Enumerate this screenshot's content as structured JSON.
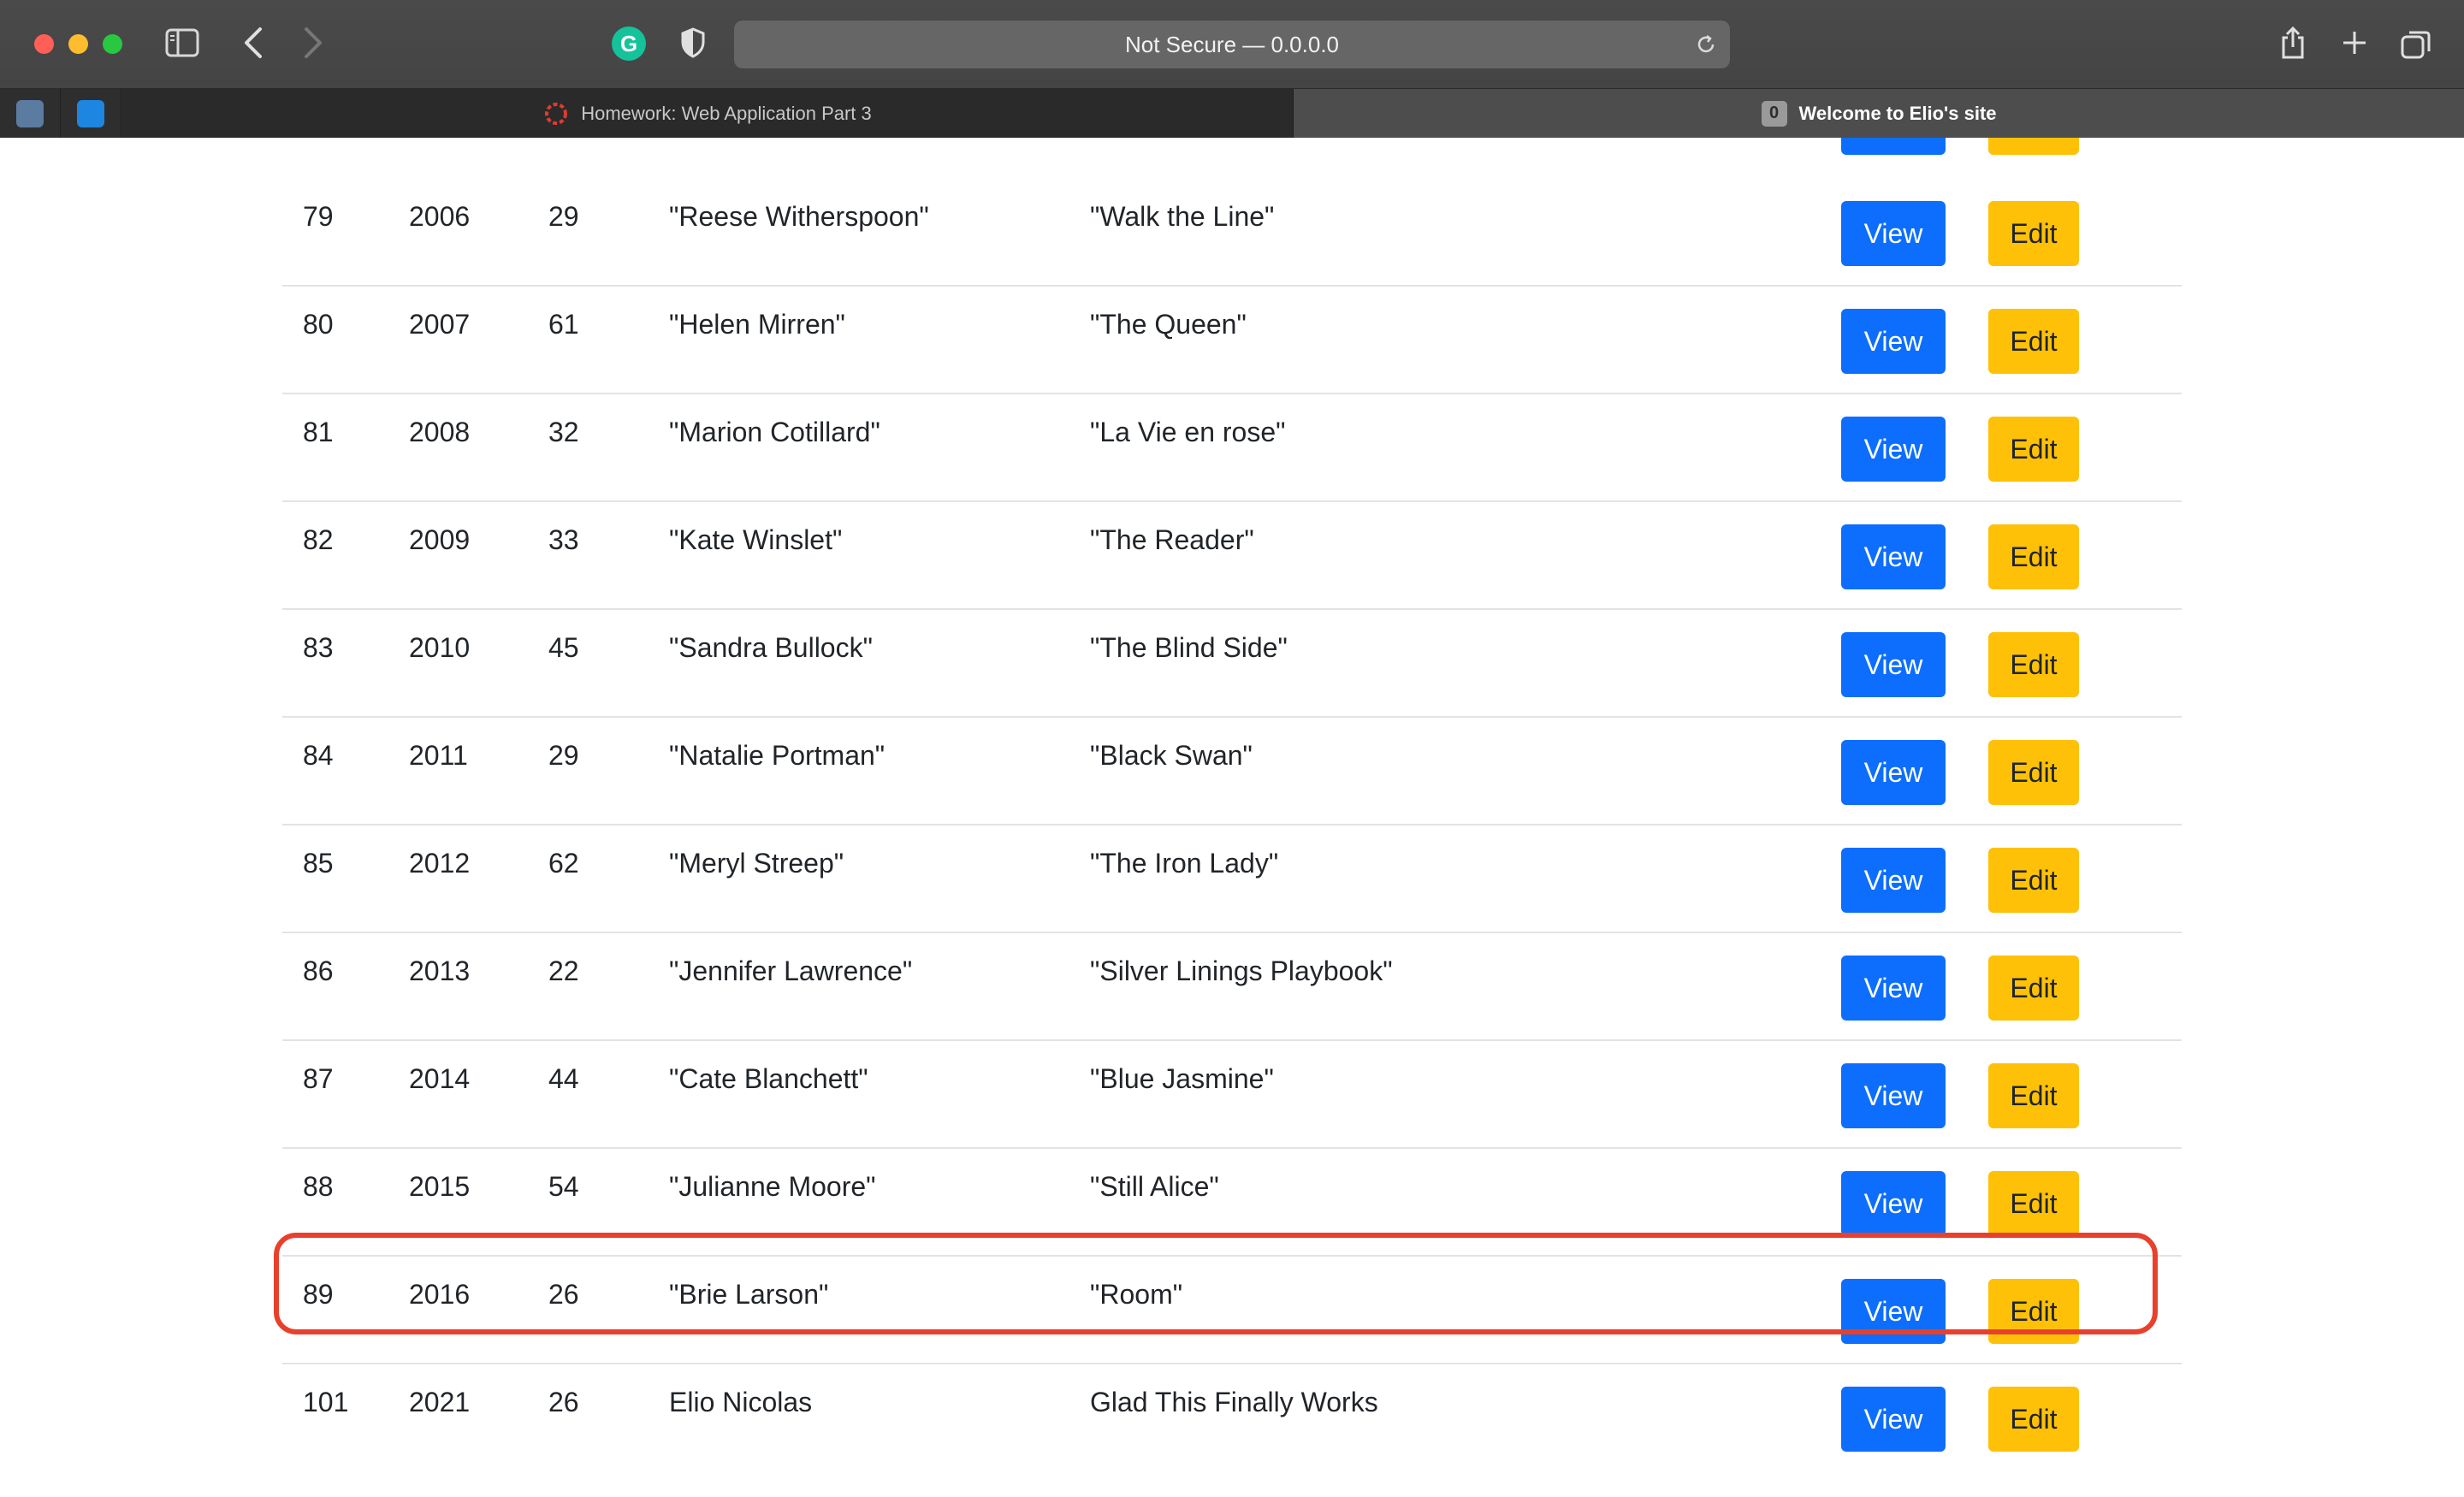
{
  "browser": {
    "address": "Not Secure — 0.0.0.0",
    "tabs": [
      {
        "label": "Homework: Web Application Part 3",
        "active": false
      },
      {
        "label": "Welcome to Elio's site",
        "active": true,
        "badge": "0"
      }
    ]
  },
  "buttons": {
    "view_label": "View",
    "edit_label": "Edit"
  },
  "rows": [
    {
      "id": "79",
      "year": "2006",
      "age": "29",
      "name": "\"Reese Witherspoon\"",
      "movie": "\"Walk the Line\""
    },
    {
      "id": "80",
      "year": "2007",
      "age": "61",
      "name": "\"Helen Mirren\"",
      "movie": "\"The Queen\""
    },
    {
      "id": "81",
      "year": "2008",
      "age": "32",
      "name": "\"Marion Cotillard\"",
      "movie": "\"La Vie en rose\""
    },
    {
      "id": "82",
      "year": "2009",
      "age": "33",
      "name": "\"Kate Winslet\"",
      "movie": "\"The Reader\""
    },
    {
      "id": "83",
      "year": "2010",
      "age": "45",
      "name": "\"Sandra Bullock\"",
      "movie": "\"The Blind Side\""
    },
    {
      "id": "84",
      "year": "2011",
      "age": "29",
      "name": "\"Natalie Portman\"",
      "movie": "\"Black Swan\""
    },
    {
      "id": "85",
      "year": "2012",
      "age": "62",
      "name": "\"Meryl Streep\"",
      "movie": "\"The Iron Lady\""
    },
    {
      "id": "86",
      "year": "2013",
      "age": "22",
      "name": "\"Jennifer Lawrence\"",
      "movie": "\"Silver Linings Playbook\""
    },
    {
      "id": "87",
      "year": "2014",
      "age": "44",
      "name": "\"Cate Blanchett\"",
      "movie": "\"Blue Jasmine\""
    },
    {
      "id": "88",
      "year": "2015",
      "age": "54",
      "name": "\"Julianne Moore\"",
      "movie": "\"Still Alice\""
    },
    {
      "id": "89",
      "year": "2016",
      "age": "26",
      "name": "\"Brie Larson\"",
      "movie": "\"Room\""
    },
    {
      "id": "101",
      "year": "2021",
      "age": "26",
      "name": "Elio Nicolas",
      "movie": "Glad This Finally Works"
    }
  ],
  "colors": {
    "view_button": "#0d6efd",
    "edit_button": "#ffc107",
    "highlight": "#e8402c"
  }
}
